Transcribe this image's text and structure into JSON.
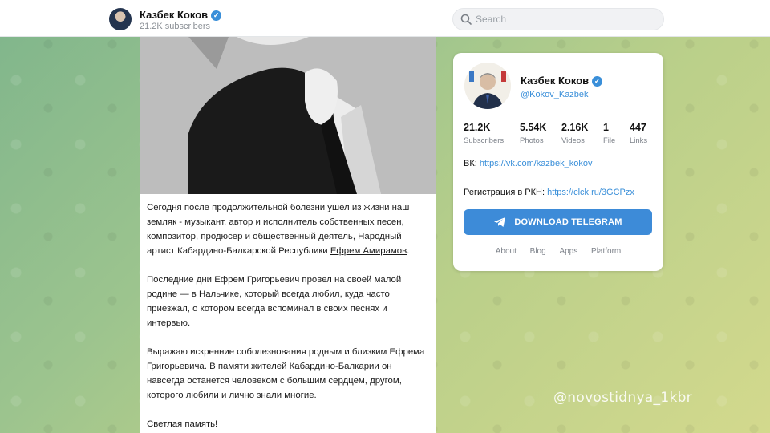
{
  "header": {
    "channel_name": "Казбек Коков",
    "subscribers": "21.2K subscribers"
  },
  "search": {
    "placeholder": "Search"
  },
  "post": {
    "paragraphs": {
      "p1_text": "Сегодня после продолжительной болезни ушел из жизни наш земляк - музыкант, автор и исполнитель собственных песен, композитор, продюсер и общественный деятель, Народный артист Кабардино-Балкарской Республики ",
      "p1_link": "Ефрем Амирамов",
      "p1_end": ".",
      "p2": "Последние дни Ефрем Григорьевич провел на своей малой родине — в Нальчике, который всегда любил, куда часто приезжал, о котором всегда вспоминал в своих песнях и интервью.",
      "p3": "Выражаю искренние соболезнования родным и близким Ефрема Григорьевича. В памяти жителей Кабардино-Балкарии он навсегда останется человеком с большим сердцем, другом, которого любили и лично знали многие.",
      "p4": "Светлая память!"
    }
  },
  "card": {
    "name": "Казбек Коков",
    "handle": "@Kokov_Kazbek",
    "stats": [
      {
        "value": "21.2K",
        "label": "Subscribers"
      },
      {
        "value": "5.54K",
        "label": "Photos"
      },
      {
        "value": "2.16K",
        "label": "Videos"
      },
      {
        "value": "1",
        "label": "File"
      },
      {
        "value": "447",
        "label": "Links"
      }
    ],
    "vk_label": "ВК:",
    "vk_link": "https://vk.com/kazbek_kokov",
    "rkn_label": "Регистрация в РКН:",
    "rkn_link": "https://clck.ru/3GCPzx",
    "download_label": "DOWNLOAD TELEGRAM",
    "footer": [
      "About",
      "Blog",
      "Apps",
      "Platform"
    ]
  },
  "watermark": "@novostidnya_1kbr",
  "colors": {
    "accent": "#3d8bd8",
    "link": "#3a8fd9",
    "verified": "#3a8fd9"
  }
}
